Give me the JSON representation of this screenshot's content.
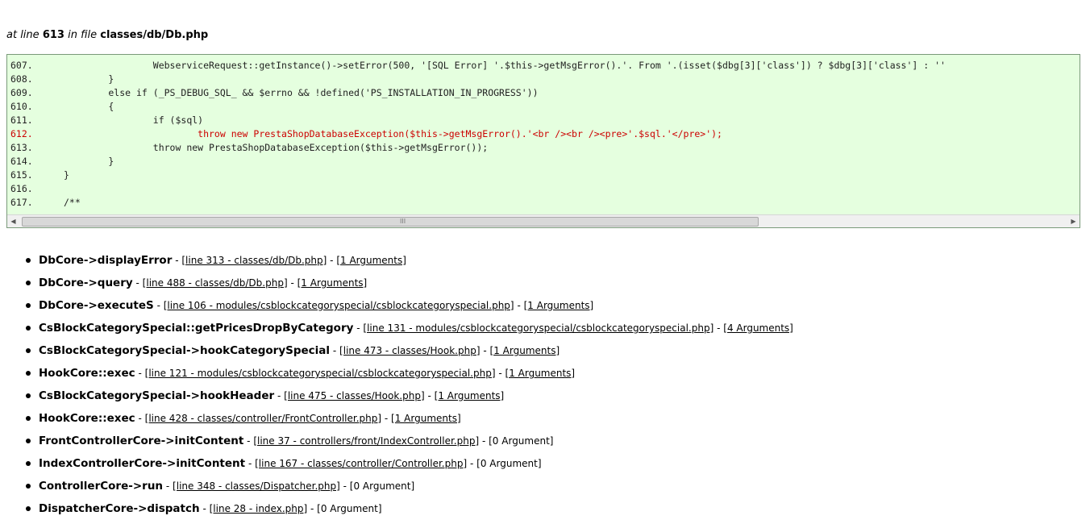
{
  "heading": {
    "prefix": "at line",
    "line": "613",
    "mid": "in file",
    "file": "classes/db/Db.php"
  },
  "code": {
    "lines": [
      {
        "num": "607.",
        "text": "                WebserviceRequest::getInstance()->setError(500, '[SQL Error] '.$this->getMsgError().'. From '.(isset($dbg[3]['class']) ? $dbg[3]['class'] : ''",
        "highlight": false
      },
      {
        "num": "608.",
        "text": "        }",
        "highlight": false
      },
      {
        "num": "609.",
        "text": "        else if (_PS_DEBUG_SQL_ && $errno && !defined('PS_INSTALLATION_IN_PROGRESS'))",
        "highlight": false
      },
      {
        "num": "610.",
        "text": "        {",
        "highlight": false
      },
      {
        "num": "611.",
        "text": "                if ($sql)",
        "highlight": false
      },
      {
        "num": "612.",
        "text": "                        throw new PrestaShopDatabaseException($this->getMsgError().'<br /><br /><pre>'.$sql.'</pre>');",
        "highlight": true
      },
      {
        "num": "613.",
        "text": "                throw new PrestaShopDatabaseException($this->getMsgError());",
        "highlight": false
      },
      {
        "num": "614.",
        "text": "        }",
        "highlight": false
      },
      {
        "num": "615.",
        "text": "}",
        "highlight": false
      },
      {
        "num": "616.",
        "text": "",
        "highlight": false
      },
      {
        "num": "617.",
        "text": "/**",
        "highlight": false
      }
    ],
    "highlight_color": "#cc0000",
    "background_color": "#e5ffdf",
    "scroll_grip": "III"
  },
  "trace": [
    {
      "fn": "DbCore->displayError",
      "loc": "[line 313 - classes/db/Db.php]",
      "args": "[1 Arguments]",
      "args_link": true
    },
    {
      "fn": "DbCore->query",
      "loc": "[line 488 - classes/db/Db.php]",
      "args": "[1 Arguments]",
      "args_link": true
    },
    {
      "fn": "DbCore->executeS",
      "loc": "[line 106 - modules/csblockcategoryspecial/csblockcategoryspecial.php]",
      "args": "[1 Arguments]",
      "args_link": true
    },
    {
      "fn": "CsBlockCategorySpecial::getPricesDropByCategory",
      "loc": "[line 131 - modules/csblockcategoryspecial/csblockcategoryspecial.php]",
      "args": "[4 Arguments]",
      "args_link": true
    },
    {
      "fn": "CsBlockCategorySpecial->hookCategorySpecial",
      "loc": "[line 473 - classes/Hook.php]",
      "args": "[1 Arguments]",
      "args_link": true
    },
    {
      "fn": "HookCore::exec",
      "loc": "[line 121 - modules/csblockcategoryspecial/csblockcategoryspecial.php]",
      "args": "[1 Arguments]",
      "args_link": true
    },
    {
      "fn": "CsBlockCategorySpecial->hookHeader",
      "loc": "[line 475 - classes/Hook.php]",
      "args": "[1 Arguments]",
      "args_link": true
    },
    {
      "fn": "HookCore::exec",
      "loc": "[line 428 - classes/controller/FrontController.php]",
      "args": "[1 Arguments]",
      "args_link": true
    },
    {
      "fn": "FrontControllerCore->initContent",
      "loc": "[line 37 - controllers/front/IndexController.php]",
      "args": "[0 Argument]",
      "args_link": false
    },
    {
      "fn": "IndexControllerCore->initContent",
      "loc": "[line 167 - classes/controller/Controller.php]",
      "args": "[0 Argument]",
      "args_link": false
    },
    {
      "fn": "ControllerCore->run",
      "loc": "[line 348 - classes/Dispatcher.php]",
      "args": "[0 Argument]",
      "args_link": false
    },
    {
      "fn": "DispatcherCore->dispatch",
      "loc": "[line 28 - index.php]",
      "args": "[0 Argument]",
      "args_link": false
    }
  ],
  "separator": "-"
}
